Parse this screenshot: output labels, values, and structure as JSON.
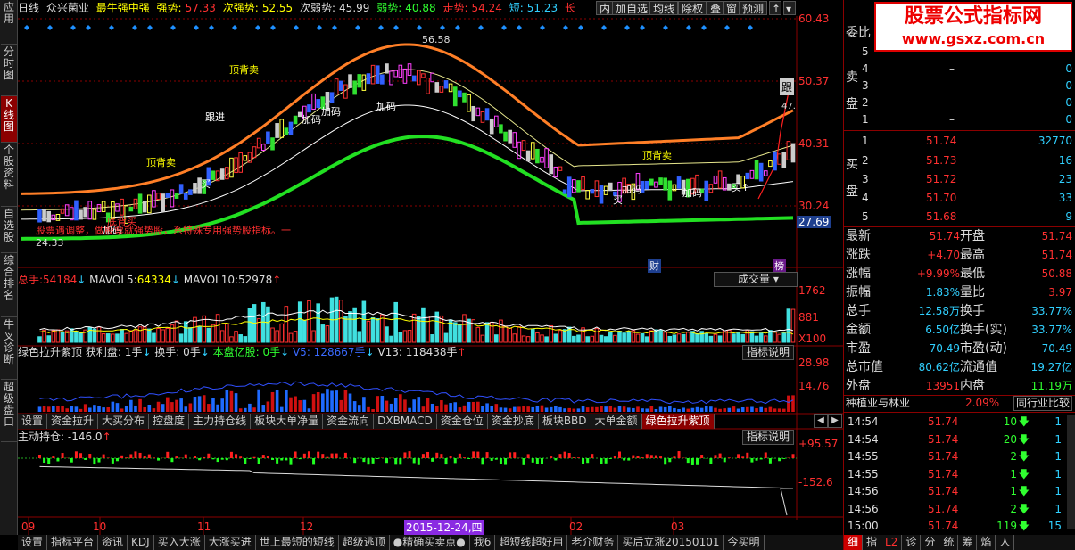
{
  "left_tabs": [
    "应用",
    "分时图",
    "K线图",
    "个股资料",
    "自选股",
    "综合排名",
    "牛叉诊断",
    "超级盘口"
  ],
  "topbar": {
    "period": "日线",
    "stock": "众兴菌业",
    "indicator": "最牛强中强",
    "strong_label": "强势:",
    "strong_val": "57.33",
    "sub_label": "次强势:",
    "sub_val": "52.55",
    "subweak_label": "次弱势:",
    "subweak_val": "45.99",
    "weak_label": "弱势:",
    "weak_val": "40.88",
    "trend_label": "走势:",
    "trend_val": "54.24",
    "short_label": "短:",
    "short_val": "51.23",
    "long_label": "长",
    "arrow": "↑"
  },
  "toolbar": {
    "b1": "内",
    "b2": "加自选",
    "b3": "均线",
    "b4": "除权",
    "b5": "叠",
    "b6": "窗",
    "b7": "预测"
  },
  "price_axis": [
    "60.43",
    "50.37",
    "40.31",
    "30.24",
    "27.69"
  ],
  "price_labels": {
    "high": "56.58",
    "low": "24.33",
    "side": "跟",
    "side_val": "47."
  },
  "markers": {
    "cai": "财",
    "bang": "榜"
  },
  "annot": [
    "顶背卖",
    "加码",
    "加码",
    "加码",
    "顶背卖",
    "买",
    "买",
    "加码",
    "买↑",
    "加码",
    "顶背卖",
    "跟进",
    "底背买",
    "加码",
    "股票遇调整，做股票就强势股，系特殊专用强势股指标。一"
  ],
  "volume": {
    "label": "总手:",
    "val": "54184",
    "ma5_label": "MAVOL5:",
    "ma5_val": "64334",
    "ma10_label": "MAVOL10:",
    "ma10_val": "52978",
    "dropdown": "成交量",
    "axis": [
      "1762",
      "881",
      "X100"
    ]
  },
  "ind2": {
    "name": "绿色拉升紫顶",
    "p1": "获利盘: 1手",
    "p2": "换手: 0手",
    "p3": "本盘亿股: 0手",
    "p4": "V5: 128667手",
    "p5": "V13: 118438手",
    "btn": "指标说明",
    "axis": [
      "28.98",
      "14.76"
    ]
  },
  "tabs": [
    "设置",
    "资金拉升",
    "大买分布",
    "控盘度",
    "主力持仓线",
    "板块大单净量",
    "资金流向",
    "DXBMACD",
    "资金仓位",
    "资金抄底",
    "板块BBD",
    "大单金额",
    "绿色拉升紫顶"
  ],
  "ind3": {
    "name": "主动持仓:",
    "val": "-146.0",
    "arrow": "↑",
    "btn": "指标说明",
    "axis": [
      "+95.57",
      "-152.6"
    ]
  },
  "xaxis": [
    "09",
    "10",
    "11",
    "12",
    "2015-12-24,四",
    "02",
    "03"
  ],
  "bottom_tabs": [
    "设置",
    "指标平台",
    "资讯",
    "KDJ",
    "买入大涨",
    "大涨买进",
    "世上最短的短线",
    "超级逃顶",
    "●精确买卖点●",
    "我6",
    "超短线超好用",
    "老介财务",
    "买后立涨20150101",
    "今买明"
  ],
  "banner": {
    "title": "股票公式指标网",
    "url": "www.gsxz.com.cn"
  },
  "orderbook": {
    "wei_label": "委比",
    "sell": [
      {
        "l": "卖5",
        "p": "",
        "v": ""
      },
      {
        "l": "4",
        "p": "–",
        "v": "0"
      },
      {
        "l": "3",
        "p": "–",
        "v": "0"
      },
      {
        "l": "2",
        "p": "–",
        "v": "0"
      },
      {
        "l": "1",
        "p": "–",
        "v": "0"
      }
    ],
    "buy": [
      {
        "l": "1",
        "p": "51.74",
        "v": "32770"
      },
      {
        "l": "2",
        "p": "51.73",
        "v": "16"
      },
      {
        "l": "3",
        "p": "51.72",
        "v": "23"
      },
      {
        "l": "4",
        "p": "51.70",
        "v": "33"
      },
      {
        "l": "5",
        "p": "51.68",
        "v": "9"
      }
    ],
    "sell_side": "卖盘",
    "buy_side": "买盘"
  },
  "quote": [
    [
      "最新",
      "51.74",
      "开盘",
      "51.74"
    ],
    [
      "涨跌",
      "+4.70",
      "最高",
      "51.74"
    ],
    [
      "涨幅",
      "+9.99%",
      "最低",
      "50.88"
    ],
    [
      "振幅",
      "1.83%",
      "量比",
      "3.97"
    ],
    [
      "总手",
      "12.58万",
      "换手",
      "33.77%"
    ],
    [
      "金额",
      "6.50亿",
      "换手(实)",
      "33.77%"
    ],
    [
      "市盈",
      "70.49",
      "市盈(动)",
      "70.49"
    ],
    [
      "总市值",
      "80.62亿",
      "流通值",
      "19.27亿"
    ],
    [
      "外盘",
      "13951",
      "内盘",
      "11.19万"
    ]
  ],
  "sector": {
    "name": "种植业与林业",
    "pct": "2.09%",
    "cmp": "同行业比较"
  },
  "ticks": [
    [
      "14:54",
      "51.74",
      "10",
      "1"
    ],
    [
      "14:54",
      "51.74",
      "20",
      "1"
    ],
    [
      "14:55",
      "51.74",
      "2",
      "1"
    ],
    [
      "14:55",
      "51.74",
      "1",
      "1"
    ],
    [
      "14:56",
      "51.74",
      "1",
      "1"
    ],
    [
      "14:56",
      "51.74",
      "2",
      "1"
    ],
    [
      "15:00",
      "51.74",
      "119",
      "15"
    ]
  ],
  "rtabs": [
    "细",
    "指",
    "L2",
    "诊",
    "分",
    "统",
    "筹",
    "焰",
    "人"
  ]
}
